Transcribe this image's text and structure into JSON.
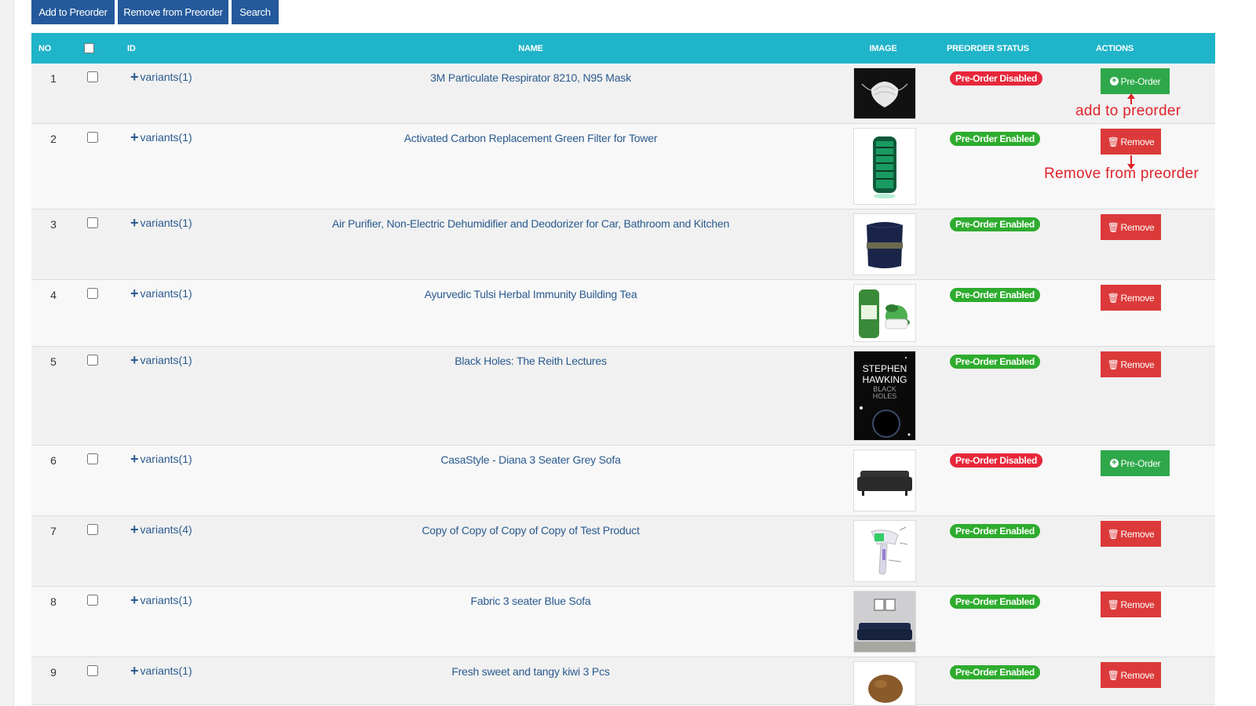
{
  "toolbar": {
    "add_label": "Add to Preorder",
    "remove_label": "Remove from Preorder",
    "search_label": "Search"
  },
  "table": {
    "headers": {
      "no": "NO",
      "id": "ID",
      "name": "NAME",
      "image": "IMAGE",
      "status": "PREORDER STATUS",
      "actions": "ACTIONS"
    },
    "rows": [
      {
        "no": "1",
        "variants": "variants(1)",
        "name": "3M Particulate Respirator 8210, N95 Mask",
        "status": "Pre-Order Disabled",
        "action": "Pre-Order"
      },
      {
        "no": "2",
        "variants": "variants(1)",
        "name": "Activated Carbon Replacement Green Filter for Tower",
        "status": "Pre-Order Enabled",
        "action": "Remove"
      },
      {
        "no": "3",
        "variants": "variants(1)",
        "name": "Air Purifier, Non-Electric Dehumidifier and Deodorizer for Car, Bathroom and Kitchen",
        "status": "Pre-Order Enabled",
        "action": "Remove"
      },
      {
        "no": "4",
        "variants": "variants(1)",
        "name": "Ayurvedic Tulsi Herbal Immunity Building Tea",
        "status": "Pre-Order Enabled",
        "action": "Remove"
      },
      {
        "no": "5",
        "variants": "variants(1)",
        "name": "Black Holes: The Reith Lectures",
        "status": "Pre-Order Enabled",
        "action": "Remove"
      },
      {
        "no": "6",
        "variants": "variants(1)",
        "name": "CasaStyle - Diana 3 Seater Grey Sofa",
        "status": "Pre-Order Disabled",
        "action": "Pre-Order"
      },
      {
        "no": "7",
        "variants": "variants(4)",
        "name": "Copy of Copy of Copy of Copy of Test Product",
        "status": "Pre-Order Enabled",
        "action": "Remove"
      },
      {
        "no": "8",
        "variants": "variants(1)",
        "name": "Fabric 3 seater Blue Sofa",
        "status": "Pre-Order Enabled",
        "action": "Remove"
      },
      {
        "no": "9",
        "variants": "variants(1)",
        "name": "Fresh sweet and tangy kiwi 3 Pcs",
        "status": "Pre-Order Enabled",
        "action": "Remove"
      }
    ]
  },
  "book_cover": {
    "author_line1": "STEPHEN",
    "author_line2": "HAWKING",
    "title_line1": "BLACK",
    "title_line2": "HOLES"
  },
  "annotations": {
    "add": "add to preorder",
    "remove": "Remove from preorder"
  },
  "colors": {
    "header_bg": "#1fb4c9",
    "toolbar_btn": "#245a9c",
    "badge_disabled": "#e7273a",
    "badge_enabled": "#2eac2e",
    "btn_remove": "#dc3a3a",
    "btn_preorder": "#2ea84a",
    "annotation": "#e0242a"
  }
}
